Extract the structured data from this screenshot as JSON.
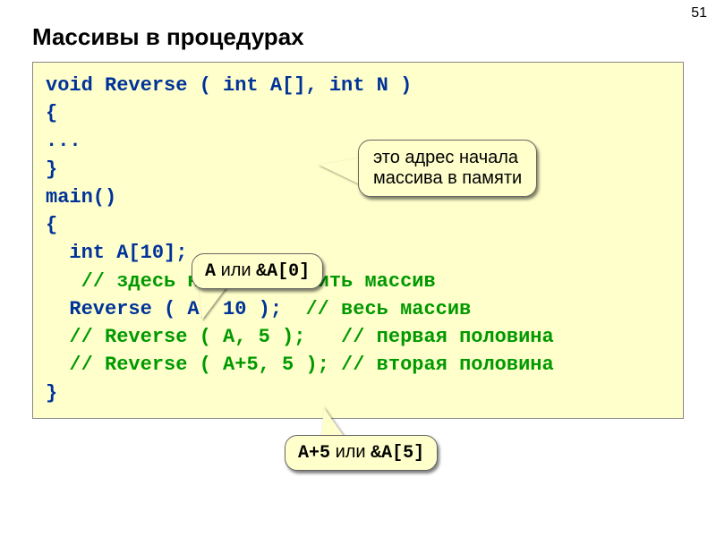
{
  "pageNumber": "51",
  "title": "Массивы в процедурах",
  "code": {
    "l1": "void Reverse ( int A[], int N )",
    "l2": "{",
    "l3": "...",
    "l4": "}",
    "l5": "main()",
    "l6": "{",
    "l7": "  int A[10];",
    "l8a": "   ",
    "l8b": "// здесь надо заполнить массив",
    "l9a": "  Reverse ( A, 10 );  ",
    "l9b": "// весь массив",
    "l10a": "  ",
    "l10b": "// Reverse ( A, 5 );   // первая половина",
    "l11a": "  ",
    "l11b": "// Reverse ( A+5, 5 ); // вторая половина",
    "l12": "}"
  },
  "callouts": {
    "c1l1": "это адрес начала",
    "c1l2": "массива в памяти",
    "c2a": "A",
    "c2mid": " или ",
    "c2b": "&A[0]",
    "c3a": "A+5",
    "c3mid": " или ",
    "c3b": "&A[5]"
  }
}
